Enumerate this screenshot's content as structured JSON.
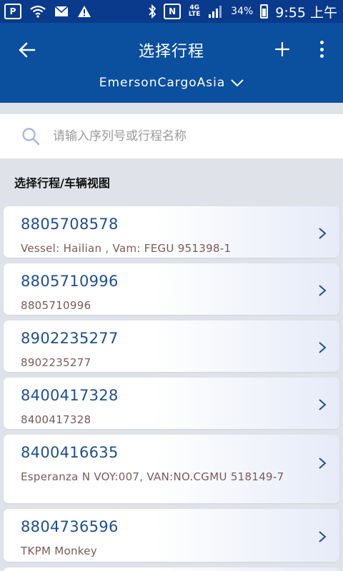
{
  "status_bar": {
    "app_badge": "P",
    "network_badge": "N",
    "net_type": "4G LTE",
    "battery": "34%",
    "time": "9:55 上午"
  },
  "header": {
    "title": "选择行程",
    "organization": "EmersonCargoAsia"
  },
  "search": {
    "placeholder": "请输入序列号或行程名称",
    "value": ""
  },
  "section_label": "选择行程/车辆视图",
  "trips": [
    {
      "id": "8805708578",
      "subtitle": "Vessel: Hailian , Vam: FEGU 951398-1"
    },
    {
      "id": "8805710996",
      "subtitle": "8805710996"
    },
    {
      "id": "8902235277",
      "subtitle": "8902235277"
    },
    {
      "id": "8400417328",
      "subtitle": "8400417328"
    },
    {
      "id": "8400416635",
      "subtitle": "Esperanza N VOY:007, VAN:NO.CGMU 518149-7"
    },
    {
      "id": "8804736596",
      "subtitle": "TKPM Monkey"
    }
  ],
  "colors": {
    "status_bar": "#0a3a8c",
    "header": "#0b4f9f",
    "trip_id": "#1d4f91",
    "trip_subtitle": "#7a5a5a",
    "background": "#dfe2e8"
  }
}
